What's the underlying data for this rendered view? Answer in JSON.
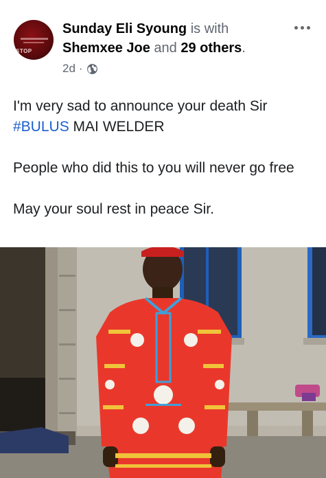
{
  "post": {
    "author": "Sunday Eli Syoung",
    "is_with": "is with",
    "tagged_friend": "Shemxee Joe",
    "and_word": "and",
    "others": "29 others",
    "period": ".",
    "time": "2d",
    "separator": "·",
    "privacy_icon": "globe-icon",
    "more_icon": "more-options-icon",
    "text": {
      "line1_prefix": "I'm very sad to announce your death Sir",
      "hashtag": "#BULUS",
      "line2_suffix": " MAI WELDER",
      "paragraph2": "People who did this to you will never go free",
      "paragraph3": "May your soul rest in peace Sir."
    }
  },
  "avatar_stamp": "STOP",
  "colors": {
    "hashtag": "#1b5fcf",
    "muted": "#606770",
    "text": "#1c1e21"
  }
}
